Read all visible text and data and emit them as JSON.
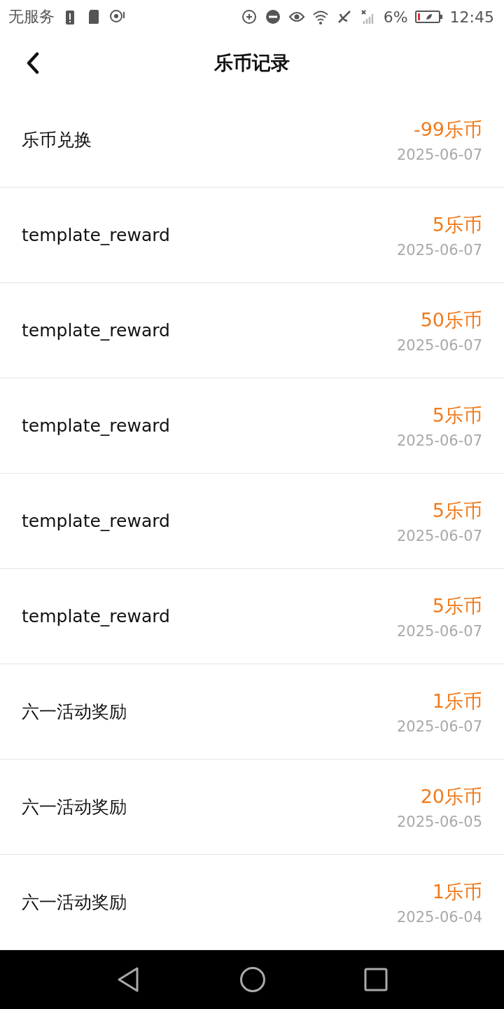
{
  "status_bar": {
    "carrier": "无服务",
    "battery_percent": "6%",
    "time": "12:45"
  },
  "header": {
    "title": "乐币记录"
  },
  "records": [
    {
      "title": "乐币兑换",
      "amount": "-99乐币",
      "date": "2025-06-07"
    },
    {
      "title": "template_reward",
      "amount": "5乐币",
      "date": "2025-06-07"
    },
    {
      "title": "template_reward",
      "amount": "50乐币",
      "date": "2025-06-07"
    },
    {
      "title": "template_reward",
      "amount": "5乐币",
      "date": "2025-06-07"
    },
    {
      "title": "template_reward",
      "amount": "5乐币",
      "date": "2025-06-07"
    },
    {
      "title": "template_reward",
      "amount": "5乐币",
      "date": "2025-06-07"
    },
    {
      "title": "六一活动奖励",
      "amount": "1乐币",
      "date": "2025-06-07"
    },
    {
      "title": "六一活动奖励",
      "amount": "20乐币",
      "date": "2025-06-05"
    },
    {
      "title": "六一活动奖励",
      "amount": "1乐币",
      "date": "2025-06-04"
    }
  ]
}
